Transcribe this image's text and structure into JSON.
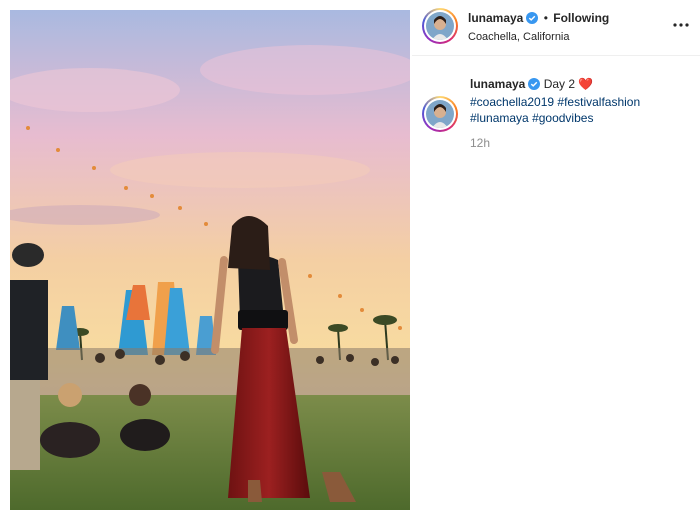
{
  "post": {
    "image_alt": "Woman in red velvet skirt at festival at sunset"
  },
  "header": {
    "username": "lunamaya",
    "separator": "•",
    "following_label": "Following",
    "location": "Coachella, California",
    "verified_icon": "verified-badge-icon",
    "more_icon": "more-options-icon"
  },
  "caption": {
    "username": "lunamaya",
    "text": "Day 2",
    "emoji": "❤️",
    "hashtags": [
      "#coachella2019",
      "#festivalfashion",
      "#lunamaya",
      "#goodvibes"
    ],
    "time": "12h"
  },
  "colors": {
    "link": "#00376b",
    "verified": "#3897f0",
    "muted": "#8e8e8e"
  }
}
